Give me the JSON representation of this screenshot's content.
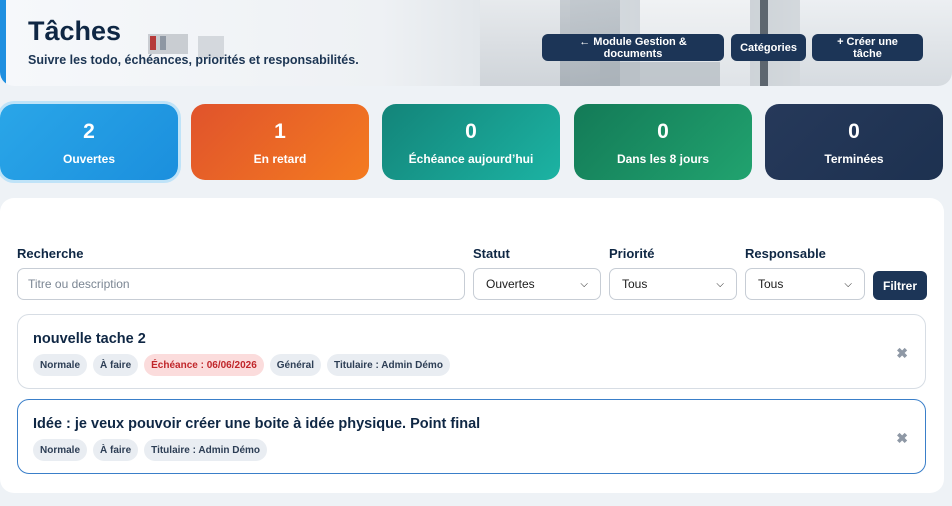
{
  "header": {
    "title": "Tâches",
    "subtitle": "Suivre les todo, échéances, priorités et responsabilités.",
    "buttons": {
      "module": "← Module Gestion & documents",
      "categories": "Catégories",
      "create": "+ Créer une tâche"
    }
  },
  "stats": [
    {
      "value": "2",
      "label": "Ouvertes"
    },
    {
      "value": "1",
      "label": "En retard"
    },
    {
      "value": "0",
      "label": "Échéance aujourd’hui"
    },
    {
      "value": "0",
      "label": "Dans les 8 jours"
    },
    {
      "value": "0",
      "label": "Terminées"
    }
  ],
  "filters": {
    "search": {
      "label": "Recherche",
      "placeholder": "Titre ou description"
    },
    "status": {
      "label": "Statut",
      "value": "Ouvertes"
    },
    "priority": {
      "label": "Priorité",
      "value": "Tous"
    },
    "owner": {
      "label": "Responsable",
      "value": "Tous"
    },
    "submit": "Filtrer"
  },
  "tasks": [
    {
      "title": "nouvelle tache 2",
      "tags": [
        "Normale",
        "À faire",
        "Échéance : 06/06/2026",
        "Général",
        "Titulaire : Admin Démo"
      ],
      "close": "✖"
    },
    {
      "title": "Idée : je veux pouvoir créer une boite à idée physique. Point final",
      "tags": [
        "Normale",
        "À faire",
        "Titulaire : Admin Démo"
      ],
      "close": "✖"
    }
  ],
  "colors": {
    "accent": "#1f8fe0",
    "primary_button": "#1c3557",
    "overdue": "#c0262a"
  }
}
